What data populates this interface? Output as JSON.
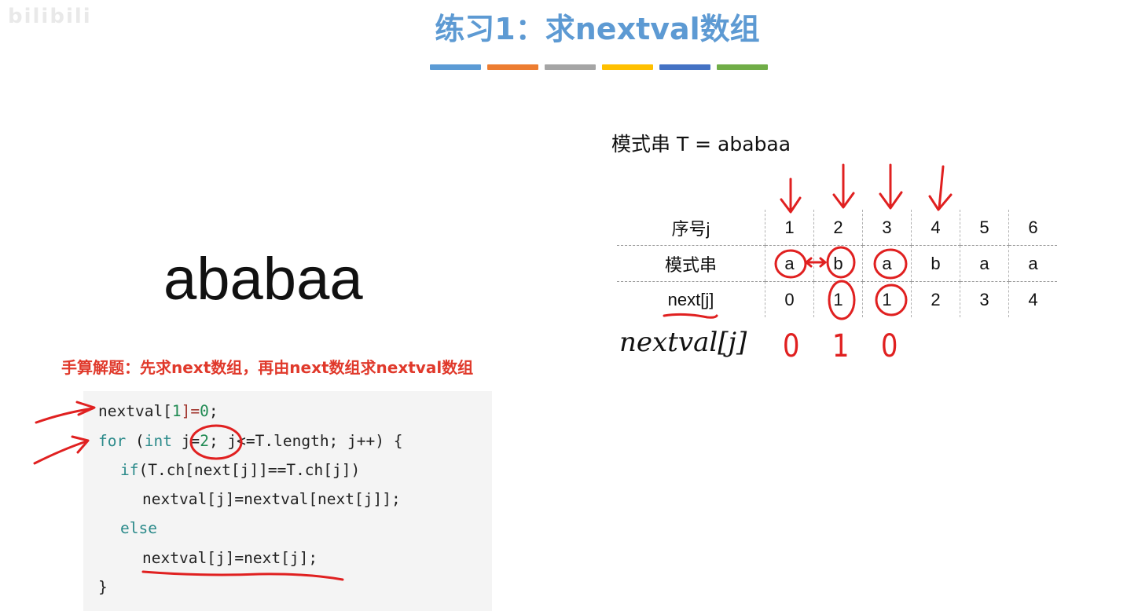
{
  "watermark": "bilibili",
  "title": "练习1：求nextval数组",
  "bar_colors": [
    "#5b9bd5",
    "#ed7d31",
    "#a5a5a5",
    "#ffc000",
    "#4472c4",
    "#70ad47"
  ],
  "big_word": "ababaa",
  "hint": "手算解题：先求next数组，再由next数组求nextval数组",
  "code": {
    "l1_a": "nextval[",
    "l1_b": "1",
    "l1_c": "]=",
    "l1_d": "0",
    "l1_e": ";",
    "l2_for": "for",
    "l2_a": " (",
    "l2_int": "int",
    "l2_b": " j=",
    "l2_c": "2",
    "l2_d": "; j<=T.length; j++) {",
    "l3_if": "if",
    "l3_a": "(T.ch[next[j]]==T.ch[j])",
    "l4": "nextval[j]=nextval[next[j]];",
    "l5": "else",
    "l6": "nextval[j]=next[j];",
    "l7": "}"
  },
  "pattern_label": "模式串 T = ababaa",
  "table": {
    "row_labels": [
      "序号j",
      "模式串",
      "next[j]"
    ],
    "index": [
      "1",
      "2",
      "3",
      "4",
      "5",
      "6"
    ],
    "chars": [
      "a",
      "b",
      "a",
      "b",
      "a",
      "a"
    ],
    "next": [
      "0",
      "1",
      "1",
      "2",
      "3",
      "4"
    ]
  },
  "handwritten": {
    "label": "nextval[j]",
    "values": [
      "0",
      "1",
      "0"
    ]
  }
}
